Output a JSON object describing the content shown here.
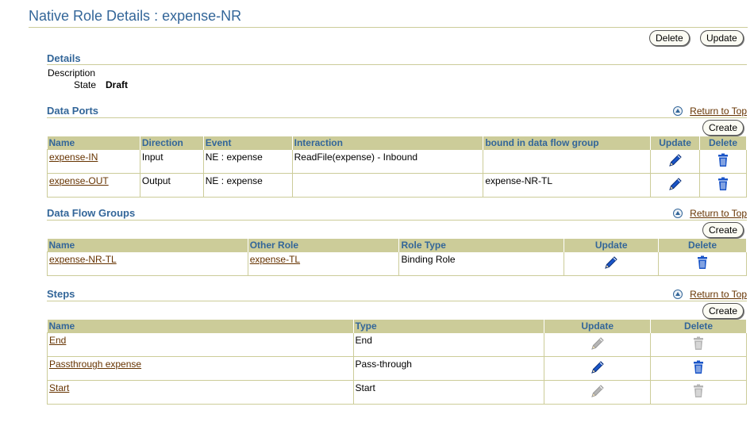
{
  "page": {
    "title": "Native Role Details : expense-NR",
    "delete_label": "Delete",
    "update_label": "Update"
  },
  "details": {
    "heading": "Details",
    "description_label": "Description",
    "description_value": "",
    "state_label": "State",
    "state_value": "Draft"
  },
  "return_to_top": "Return to Top",
  "create_label": "Create",
  "colors": {
    "title": "#336699",
    "header_bg": "#cccc99",
    "link": "#663300",
    "icon_active": "#1a55c8",
    "icon_disabled": "#b5b5b5"
  },
  "data_ports": {
    "heading": "Data Ports",
    "columns": [
      "Name",
      "Direction",
      "Event",
      "Interaction",
      "bound in data flow group",
      "Update",
      "Delete"
    ],
    "rows": [
      {
        "name": "expense-IN",
        "direction": "Input",
        "event": "NE : expense",
        "interaction": "ReadFile(expense) - Inbound",
        "group": ""
      },
      {
        "name": "expense-OUT",
        "direction": "Output",
        "event": "NE : expense",
        "interaction": "",
        "group": "expense-NR-TL"
      }
    ]
  },
  "data_flow_groups": {
    "heading": "Data Flow Groups",
    "columns": [
      "Name",
      "Other Role",
      "Role Type",
      "Update",
      "Delete"
    ],
    "rows": [
      {
        "name": "expense-NR-TL",
        "other_role": "expense-TL",
        "role_type": "Binding Role"
      }
    ]
  },
  "steps": {
    "heading": "Steps",
    "columns": [
      "Name",
      "Type",
      "Update",
      "Delete"
    ],
    "rows": [
      {
        "name": "End",
        "type": "End",
        "enabled": false
      },
      {
        "name": "Passthrough expense",
        "type": "Pass-through",
        "enabled": true
      },
      {
        "name": "Start",
        "type": "Start",
        "enabled": false
      }
    ]
  },
  "icons": {
    "update": "pencil-icon",
    "delete": "trash-icon",
    "return_to_top": "arrow-up-circle-icon"
  }
}
